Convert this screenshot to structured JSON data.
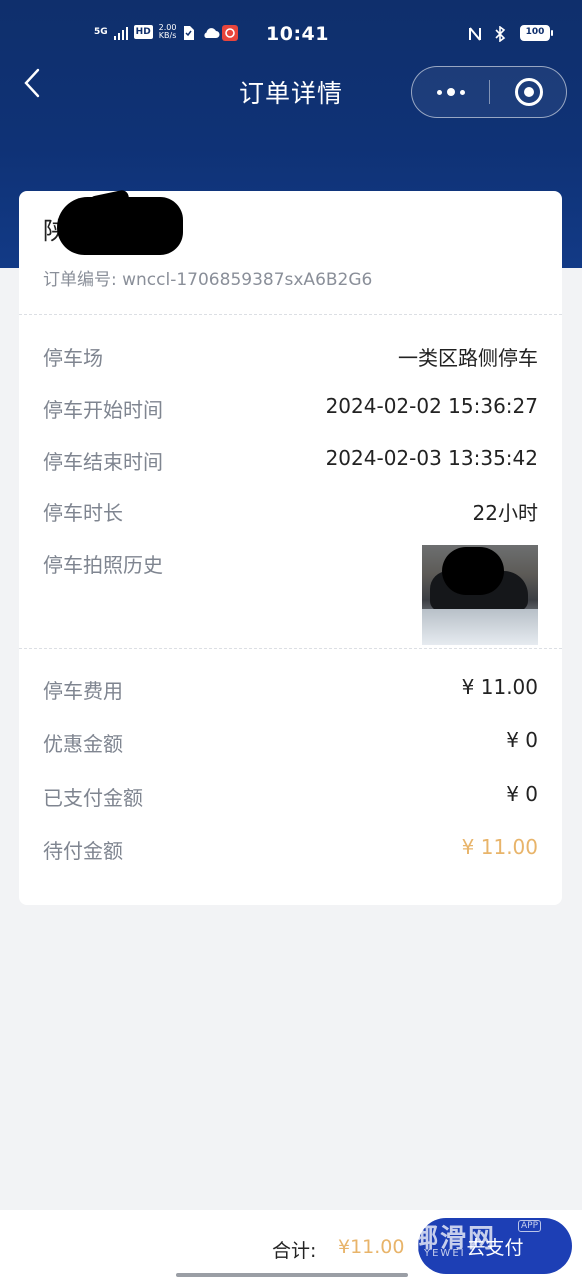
{
  "status_bar": {
    "network": "5G",
    "hd": "HD",
    "speed_value": "2.00",
    "speed_unit": "KB/s",
    "time": "10:41",
    "battery": "100"
  },
  "nav": {
    "title": "订单详情"
  },
  "order": {
    "plate": "陕",
    "order_no": "订单编号: wnccl-1706859387sxA6B2G6"
  },
  "parking_info": [
    {
      "label": "停车场",
      "value": "一类区路侧停车"
    },
    {
      "label": "停车开始时间",
      "value": "2024-02-02 15:36:27"
    },
    {
      "label": "停车结束时间",
      "value": "2024-02-03 13:35:42"
    },
    {
      "label": "停车时长",
      "value": "22小时"
    },
    {
      "label": "停车拍照历史",
      "value": ""
    }
  ],
  "fees": [
    {
      "label": "停车费用",
      "value": "¥ 11.00"
    },
    {
      "label": "优惠金额",
      "value": "¥ 0"
    },
    {
      "label": "已支付金额",
      "value": "¥ 0"
    },
    {
      "label": "待付金额",
      "value": "¥ 11.00"
    }
  ],
  "colors": {
    "header": "#0f2f6c",
    "accent_orange": "#e8b46a",
    "pay_button": "#1d3fb5"
  },
  "bottom": {
    "total_label": "合计:",
    "total_value": "¥11.00",
    "pay_label": "去支付"
  },
  "watermark": {
    "text": "椰滑网",
    "sub": "YEWEI",
    "badge": "APP"
  }
}
